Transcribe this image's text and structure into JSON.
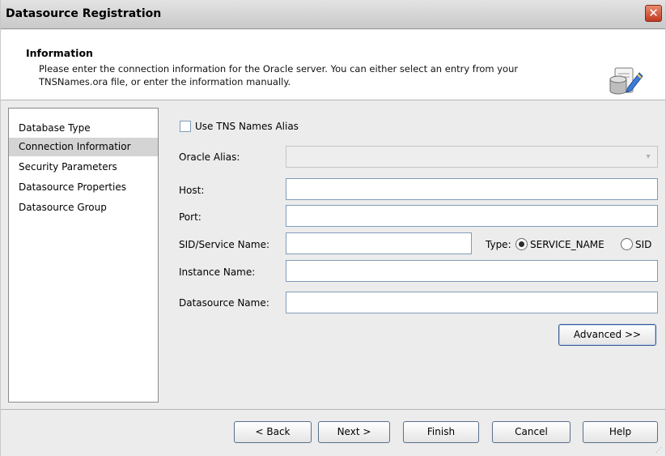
{
  "window": {
    "title": "Datasource Registration",
    "close_icon": "close-icon"
  },
  "info": {
    "title": "Information",
    "line1": "Please enter the connection information for the Oracle server.  You can either select an entry from your",
    "line2": "TNSNames.ora file, or enter the information manually.",
    "icon": "database-edit-icon"
  },
  "nav": {
    "items": [
      {
        "label": "Database Type"
      },
      {
        "label": "Connection Informatior"
      },
      {
        "label": "Security Parameters"
      },
      {
        "label": "Datasource Properties"
      },
      {
        "label": "Datasource Group"
      }
    ],
    "selected_index": 1
  },
  "form": {
    "use_tns_label": "Use TNS Names Alias",
    "use_tns_checked": false,
    "oracle_alias_label": "Oracle Alias:",
    "oracle_alias_value": "",
    "host_label": "Host:",
    "host_value": "",
    "port_label": "Port:",
    "port_value": "",
    "sid_label": "SID/Service Name:",
    "sid_value": "",
    "type_label": "Type:",
    "type_options": [
      "SERVICE_NAME",
      "SID"
    ],
    "type_selected": "SERVICE_NAME",
    "instance_label": "Instance Name:",
    "instance_value": "",
    "datasource_label": "Datasource Name:",
    "datasource_value": "",
    "advanced_label": "Advanced >>"
  },
  "footer": {
    "back_label": "< Back",
    "next_label": "Next >",
    "finish_label": "Finish",
    "cancel_label": "Cancel",
    "help_label": "Help"
  }
}
